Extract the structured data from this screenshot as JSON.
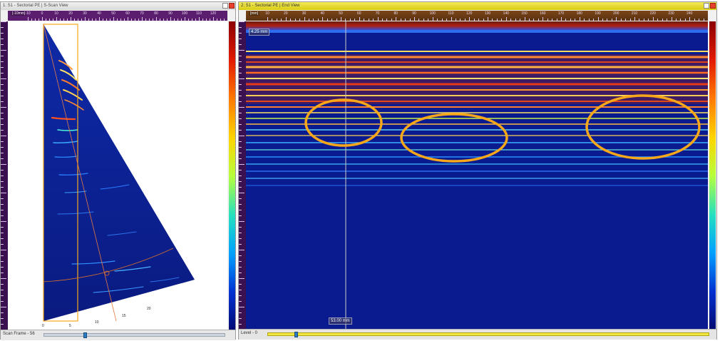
{
  "left_panel": {
    "title": "1: S1 - Sectorial PE | S-Scan View",
    "units_label": "[-10mm]",
    "ruler_ticks": [
      "-10",
      "0",
      "10",
      "20",
      "30",
      "40",
      "50",
      "60",
      "70",
      "80",
      "90",
      "100",
      "110",
      "120"
    ],
    "depth_labels": [
      "0",
      "25",
      "50",
      "75"
    ],
    "bottom_scale": [
      "0",
      "5",
      "10",
      "15",
      "20"
    ],
    "status_text": "Scan Frame - 56",
    "slider_position": 0.22
  },
  "right_panel": {
    "title": "2: S1 - Sectorial PE | End View",
    "units_label": "[mm]",
    "ruler_ticks": [
      "10",
      "20",
      "30",
      "40",
      "50",
      "60",
      "70",
      "80",
      "90",
      "100",
      "110",
      "120",
      "130",
      "140",
      "150",
      "160",
      "170",
      "180",
      "190",
      "200",
      "210",
      "220",
      "230",
      "240"
    ],
    "readout_top": "4.25 mm",
    "readout_cursor": "53.00 mm",
    "status_text": "Level - 0",
    "slider_position": 0.06
  },
  "colors": {
    "background_blue": "#0a1a8f",
    "highlight_orange": "#f6a81a",
    "right_title_yellow": "#e0d520"
  },
  "icons": [
    "maximize-icon",
    "close-icon",
    "slider-thumb-icon"
  ]
}
